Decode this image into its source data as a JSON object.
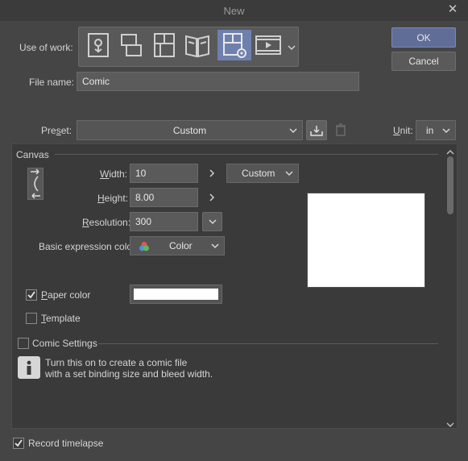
{
  "window": {
    "title": "New",
    "close_icon": "close-icon"
  },
  "use_of_work": {
    "label": "Use of work:",
    "options": [
      {
        "name": "illustration",
        "icon": "illustration-icon",
        "selected": false
      },
      {
        "name": "webtoon",
        "icon": "webtoon-icon",
        "selected": false
      },
      {
        "name": "comic",
        "icon": "comic-icon",
        "selected": false
      },
      {
        "name": "show-all-comic-settings",
        "icon": "book-icon",
        "selected": false
      },
      {
        "name": "comic-settings",
        "icon": "comic-settings-icon",
        "selected": true
      },
      {
        "name": "animation",
        "icon": "animation-icon",
        "selected": false
      }
    ]
  },
  "file_name": {
    "label": "File name:",
    "value": "Comic"
  },
  "buttons": {
    "ok": "OK",
    "cancel": "Cancel"
  },
  "preset": {
    "label": "Preset:",
    "value": "Custom"
  },
  "unit": {
    "label": "Unit:",
    "value": "in"
  },
  "canvas": {
    "section_label": "Canvas",
    "width": {
      "label": "Width:",
      "value": "10"
    },
    "height": {
      "label": "Height:",
      "value": "8.00"
    },
    "size_preset": "Custom",
    "resolution": {
      "label": "Resolution:",
      "value": "300"
    },
    "basic_color": {
      "label": "Basic expression color:",
      "value": "Color"
    },
    "paper_color": {
      "label": "Paper color",
      "checked": true,
      "color": "#ffffff"
    },
    "template": {
      "label": "Template",
      "checked": false
    }
  },
  "comic_settings": {
    "label": "Comic Settings",
    "checked": false,
    "info_line1": "Turn this on to create a comic file",
    "info_line2": "with a set binding size and bleed width."
  },
  "record_timelapse": {
    "label": "Record timelapse",
    "checked": true
  },
  "colors": {
    "accent": "#6f7fae",
    "dialog_bg": "#454545",
    "panel_bg": "#3a3a3a"
  }
}
